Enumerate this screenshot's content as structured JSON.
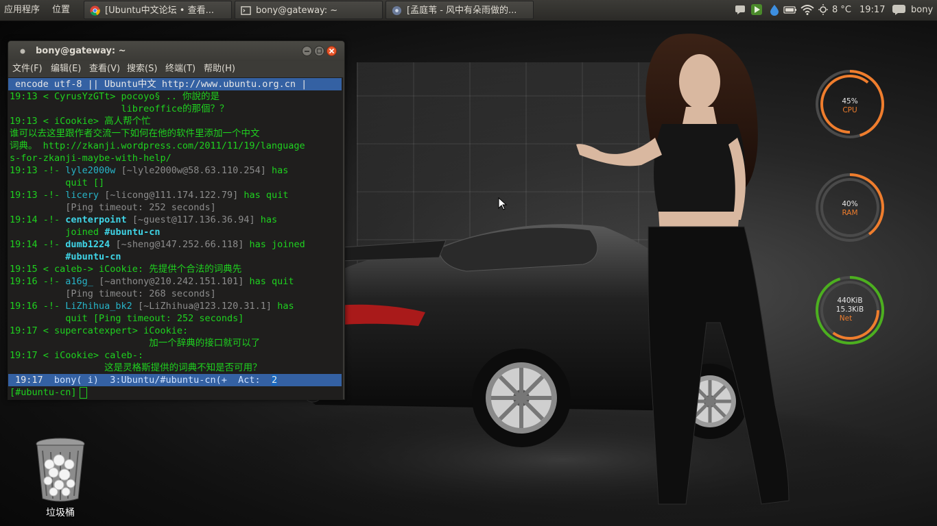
{
  "top_panel": {
    "applications": "应用程序",
    "places": "位置",
    "tasks": [
      {
        "label": "[Ubuntu中文论坛 • 查看...",
        "icon": "chrome-icon"
      },
      {
        "label": "bony@gateway: ~",
        "icon": "terminal-icon"
      },
      {
        "label": "[孟庭苇 - 风中有朵雨做的...",
        "icon": "music-player-icon"
      }
    ],
    "weather": "8 °C",
    "clock": "19:17",
    "user": "bony"
  },
  "terminal": {
    "title": "bony@gateway: ~",
    "menu": [
      "文件(F)",
      "编辑(E)",
      "查看(V)",
      "搜索(S)",
      "终端(T)",
      "帮助(H)"
    ],
    "topic": "encode utf-8 || Ubuntu中文 http://www.ubuntu.org.cn |",
    "lines": [
      {
        "t": "19:13 < CyrusYzGTt> pocoyo§ .. 你說的是"
      },
      {
        "t": "                    libreoffice的那個？？"
      },
      {
        "t": "19:13 < iCookie> 高人帮个忙"
      },
      {
        "t": "谁可以去这里跟作者交流一下如何在他的软件里添加一个中文"
      },
      {
        "t": "词典。 http://zkanji.wordpress.com/2011/11/19/language"
      },
      {
        "t": "s-for-zkanji-maybe-with-help/"
      },
      {
        "time": "19:13",
        "nick": "lyle2000w",
        "host": "[~lyle2000w@58.63.110.254]",
        "action": "has"
      },
      {
        "t": "          quit []"
      },
      {
        "time": "19:13",
        "nick": "licery",
        "host": "[~licong@111.174.122.79]",
        "action": "has quit"
      },
      {
        "t": "          [Ping timeout: 252 seconds]"
      },
      {
        "time": "19:14",
        "nick": "centerpoint",
        "host": "[~guest@117.136.36.94]",
        "action": "has"
      },
      {
        "t": "          joined",
        "channel": "#ubuntu-cn"
      },
      {
        "time": "19:14",
        "nick": "dumb1224",
        "host": "[~sheng@147.252.66.118]",
        "action": "has joined"
      },
      {
        "t": "          ",
        "channel": "#ubuntu-cn"
      },
      {
        "t": "19:15 < caleb-> iCookie: 先提供个合法的词典先"
      },
      {
        "time": "19:16",
        "nick": "a16g_",
        "host": "[~anthony@210.242.151.101]",
        "action": "has quit"
      },
      {
        "t": "          [Ping timeout: 268 seconds]"
      },
      {
        "time": "19:16",
        "nick": "LiZhihua_bk2",
        "host": "[~LiZhihua@123.120.31.1]",
        "action": "has"
      },
      {
        "t": "          quit [Ping timeout: 252 seconds]"
      },
      {
        "t": "19:17 < supercatexpert> iCookie:"
      },
      {
        "t": "                         加一个辞典的接口就可以了"
      },
      {
        "t": "19:17 < iCookie> caleb-:"
      },
      {
        "t": "                 这是灵格斯提供的词典不知是否可用？"
      }
    ],
    "status": {
      "time": "19:17",
      "nick": "bony( i)",
      "window": "3:Ubuntu/#ubuntu-cn(+",
      "act_label": "Act:",
      "act_value": "2"
    },
    "prompt": "[#ubuntu-cn]"
  },
  "conky": {
    "cpu": {
      "value": "45%",
      "label": "CPU",
      "fraction": 0.45
    },
    "ram": {
      "value": "40%",
      "label": "RAM",
      "fraction": 0.4
    },
    "net": {
      "down": "440KiB",
      "up": "15.3KiB",
      "label": "Net",
      "fraction_outer": 0.95,
      "fraction_inner": 0.35
    }
  },
  "desktop": {
    "trash_label": "垃圾桶"
  },
  "colors": {
    "orange": "#ef7d2d",
    "green": "#4caf1f",
    "terminal_green": "#1fd21f",
    "irssi_blue": "#3461a3"
  }
}
